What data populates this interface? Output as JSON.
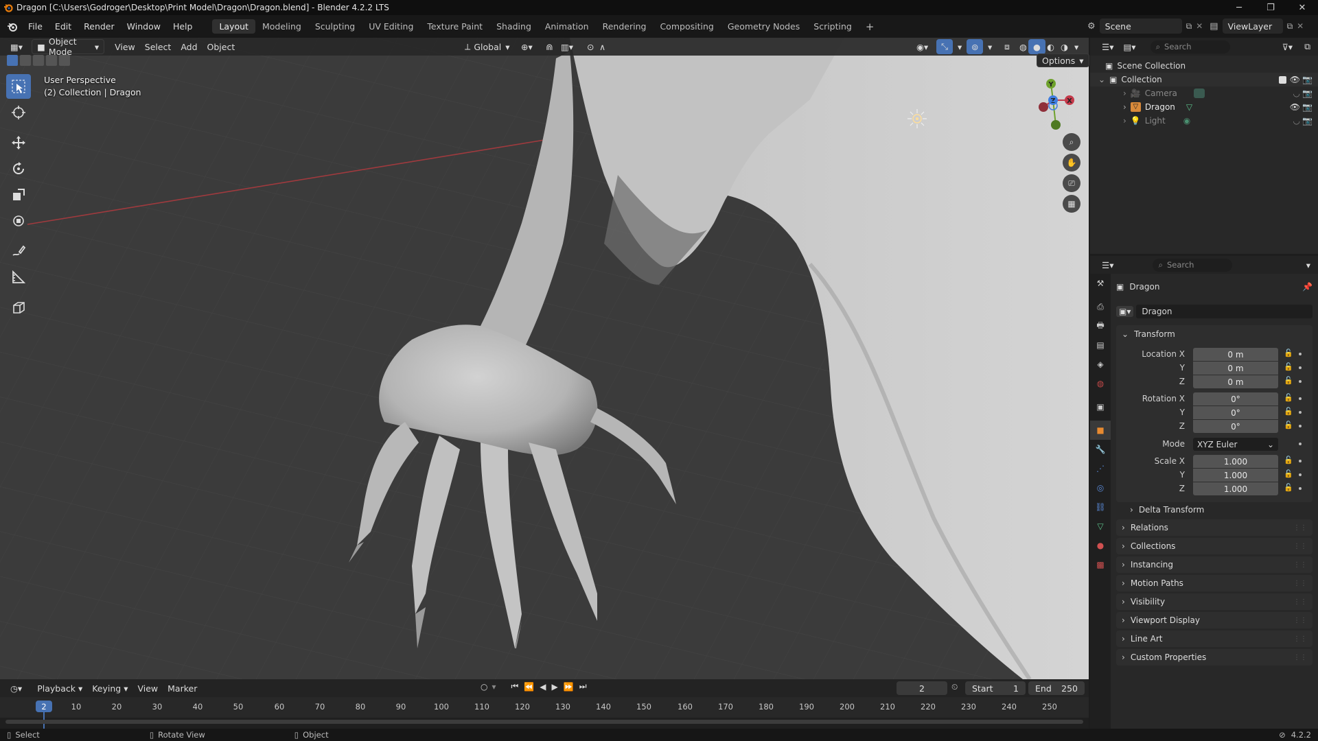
{
  "titlebar": {
    "title": "Dragon [C:\\Users\\Godroger\\Desktop\\Print Model\\Dragon\\Dragon.blend] - Blender 4.2.2 LTS",
    "minimize": "─",
    "maximize": "❐",
    "close": "✕"
  },
  "menu": [
    "File",
    "Edit",
    "Render",
    "Window",
    "Help"
  ],
  "workspaces": [
    "Layout",
    "Modeling",
    "Sculpting",
    "UV Editing",
    "Texture Paint",
    "Shading",
    "Animation",
    "Rendering",
    "Compositing",
    "Geometry Nodes",
    "Scripting"
  ],
  "active_workspace": "Layout",
  "scene": {
    "name": "Scene",
    "view_layer": "ViewLayer"
  },
  "viewport": {
    "mode": "Object Mode",
    "menus": [
      "View",
      "Select",
      "Add",
      "Object"
    ],
    "transform_orientation": "Global",
    "options": "Options",
    "info_line1": "User Perspective",
    "info_line2": "(2) Collection | Dragon",
    "gizmo": {
      "x": "X",
      "y": "Y",
      "z": "Z"
    }
  },
  "outliner": {
    "search_placeholder": "Search",
    "root": "Scene Collection",
    "collection": "Collection",
    "items": [
      {
        "name": "Camera"
      },
      {
        "name": "Dragon"
      },
      {
        "name": "Light"
      }
    ]
  },
  "properties": {
    "search_placeholder": "Search",
    "object_name": "Dragon",
    "datablock_name": "Dragon",
    "transform_title": "Transform",
    "location_label": "Location X",
    "rotation_label": "Rotation X",
    "scale_label": "Scale X",
    "axis_y": "Y",
    "axis_z": "Z",
    "location": [
      "0 m",
      "0 m",
      "0 m"
    ],
    "rotation": [
      "0°",
      "0°",
      "0°"
    ],
    "mode_label": "Mode",
    "rotation_mode": "XYZ Euler",
    "scale": [
      "1.000",
      "1.000",
      "1.000"
    ],
    "delta_transform": "Delta Transform",
    "panels": [
      "Relations",
      "Collections",
      "Instancing",
      "Motion Paths",
      "Visibility",
      "Viewport Display",
      "Line Art",
      "Custom Properties"
    ]
  },
  "timeline": {
    "menus": [
      "Playback",
      "Keying",
      "View",
      "Marker"
    ],
    "current_frame": "2",
    "start_label": "Start",
    "start": "1",
    "end_label": "End",
    "end": "250",
    "ruler": [
      "10",
      "20",
      "30",
      "40",
      "50",
      "60",
      "70",
      "80",
      "90",
      "100",
      "110",
      "120",
      "130",
      "140",
      "150",
      "160",
      "170",
      "180",
      "190",
      "200",
      "210",
      "220",
      "230",
      "240",
      "250"
    ]
  },
  "statusbar": {
    "select": "Select",
    "rotate": "Rotate View",
    "object": "Object",
    "version": "4.2.2"
  }
}
